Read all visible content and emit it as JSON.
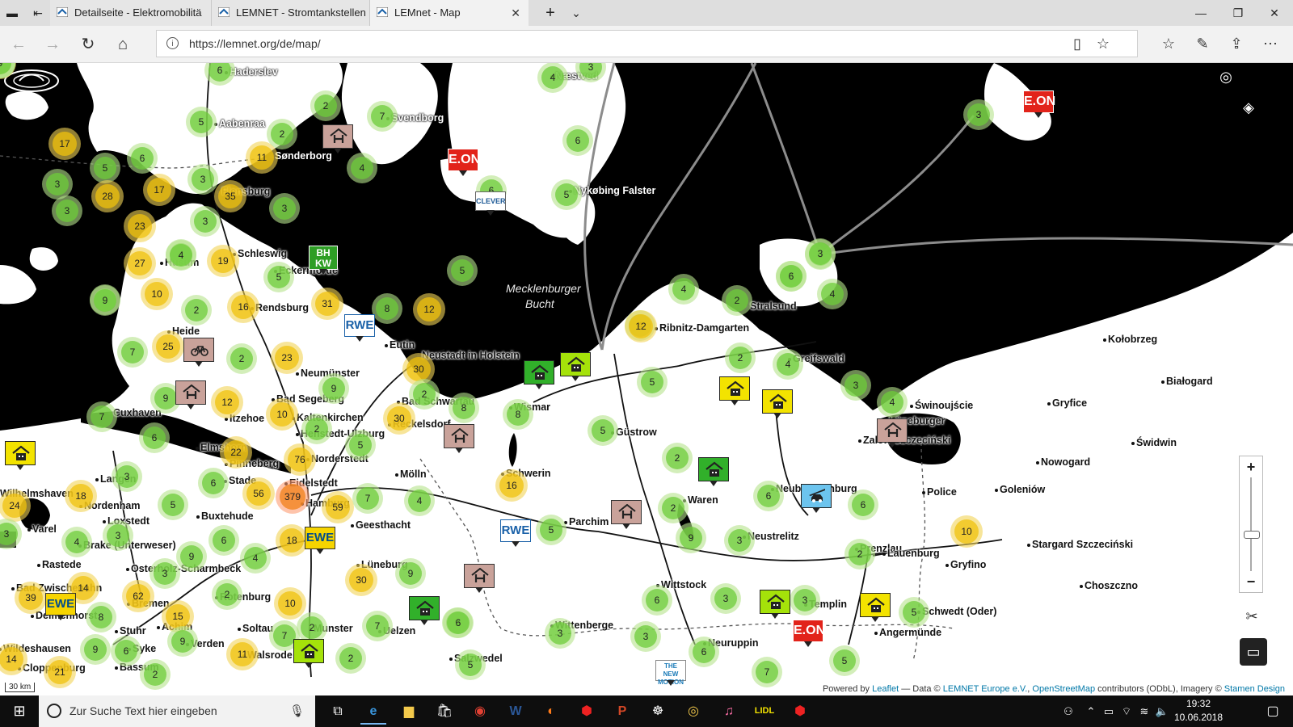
{
  "tabs": [
    {
      "label": "Detailseite - Elektromobilitä",
      "active": false
    },
    {
      "label": "LEMNET - Stromtankstellen",
      "active": false
    },
    {
      "label": "LEMnet - Map",
      "active": true
    }
  ],
  "address": {
    "url": "https://lemnet.org/de/map/"
  },
  "map": {
    "sea_label_line1": "Mecklenburger",
    "sea_label_line2": "Bucht",
    "zoom_in": "+",
    "zoom_out": "−",
    "scale": "30 km",
    "attribution": {
      "powered": "Powered by ",
      "leaflet": "Leaflet",
      "data": " — Data © ",
      "lemnet": "LEMNET Europe e.V.",
      "sep1": ", ",
      "osm": "OpenStreetMap",
      "contrib": " contributors (ODbL), Imagery © ",
      "stamen": "Stamen Design"
    },
    "places": [
      {
        "name": "Haderslev",
        "white": true
      },
      {
        "name": "Aabenraa",
        "white": true
      },
      {
        "name": "Sønderborg",
        "white": true
      },
      {
        "name": "Svendborg",
        "white": true
      },
      {
        "name": "Næstved",
        "white": true
      },
      {
        "name": "Nykøbing Falster",
        "white": true
      },
      {
        "name": "Flensburg"
      },
      {
        "name": "Schleswig"
      },
      {
        "name": "Husum"
      },
      {
        "name": "Eckernförde"
      },
      {
        "name": "Rendsburg"
      },
      {
        "name": "Heide"
      },
      {
        "name": "Eutin"
      },
      {
        "name": "Neustadt in Holstein"
      },
      {
        "name": "Neumünster"
      },
      {
        "name": "Bad Segeberg"
      },
      {
        "name": "Kaltenkirchen"
      },
      {
        "name": "Itzehoe"
      },
      {
        "name": "Cuxhaven"
      },
      {
        "name": "Henstedt-Ulzburg"
      },
      {
        "name": "Bad Schwartau"
      },
      {
        "name": "Reckelsdorf"
      },
      {
        "name": "Wismar"
      },
      {
        "name": "Elmshorn"
      },
      {
        "name": "Pinneberg"
      },
      {
        "name": "Norderstedt"
      },
      {
        "name": "Langen"
      },
      {
        "name": "Stade"
      },
      {
        "name": "Eidelstedt"
      },
      {
        "name": "Wilhelmshaven"
      },
      {
        "name": "Nordenham"
      },
      {
        "name": "Loxstedt"
      },
      {
        "name": "Buxtehude"
      },
      {
        "name": "Hamburg"
      },
      {
        "name": "Geesthacht"
      },
      {
        "name": "Mölln"
      },
      {
        "name": "Varel"
      },
      {
        "name": "Brake (Unterweser)"
      },
      {
        "name": "Rastede"
      },
      {
        "name": "Osterholz-Scharmbeck"
      },
      {
        "name": "Lüneburg"
      },
      {
        "name": "Bad Zwischenahn"
      },
      {
        "name": "Delmenhorst"
      },
      {
        "name": "Bremen"
      },
      {
        "name": "Rotenburg"
      },
      {
        "name": "Stuhr"
      },
      {
        "name": "Achim"
      },
      {
        "name": "Soltau"
      },
      {
        "name": "Munster"
      },
      {
        "name": "Uelzen"
      },
      {
        "name": "Verden"
      },
      {
        "name": "Walsrode"
      },
      {
        "name": "Syke"
      },
      {
        "name": "Bassum"
      },
      {
        "name": "Wildeshausen"
      },
      {
        "name": "Cloppenburg"
      },
      {
        "name": "Schwerin"
      },
      {
        "name": "Güstrow"
      },
      {
        "name": "Parchim"
      },
      {
        "name": "Waren"
      },
      {
        "name": "Neustrelitz"
      },
      {
        "name": "Wittstock"
      },
      {
        "name": "Wittenberge"
      },
      {
        "name": "Salzwedel"
      },
      {
        "name": "Neuruppin"
      },
      {
        "name": "Templin"
      },
      {
        "name": "Angermünde"
      },
      {
        "name": "Schwedt (Oder)"
      },
      {
        "name": "Prenzlau"
      },
      {
        "name": "Neubrandenburg"
      },
      {
        "name": "Ribnitz-Damgarten"
      },
      {
        "name": "Stralsund"
      },
      {
        "name": "Greifswald"
      },
      {
        "name": "Świnoujście"
      },
      {
        "name": "Kołobrzeg"
      },
      {
        "name": "Białogard"
      },
      {
        "name": "Gryfice"
      },
      {
        "name": "Świdwin"
      },
      {
        "name": "Nowogard"
      },
      {
        "name": "Police"
      },
      {
        "name": "Goleniów"
      },
      {
        "name": "Stargard Szczeciński"
      },
      {
        "name": "Gryfino"
      },
      {
        "name": "Choszczno"
      },
      {
        "name": "Zalew Szczeciński"
      },
      {
        "name": "Lüneburger"
      },
      {
        "name": "Lauenburg"
      }
    ],
    "clusters": [
      "6",
      "5",
      "2",
      "7",
      "4",
      "3",
      "4",
      "17",
      "5",
      "6",
      "11",
      "2",
      "3",
      "6",
      "3",
      "28",
      "17",
      "35",
      "3",
      "5",
      "3",
      "4",
      "3",
      "6",
      "23",
      "3",
      "27",
      "4",
      "19",
      "7",
      "5",
      "6",
      "5",
      "4",
      "9",
      "10",
      "2",
      "16",
      "31",
      "8",
      "12",
      "25",
      "7",
      "2",
      "23",
      "30",
      "9",
      "2",
      "8",
      "9",
      "12",
      "10",
      "2",
      "8",
      "30",
      "7",
      "6",
      "22",
      "76",
      "5",
      "3",
      "6",
      "56",
      "379",
      "59",
      "7",
      "4",
      "9",
      "3",
      "18",
      "5",
      "6",
      "4",
      "18",
      "24",
      "3",
      "4",
      "3",
      "16",
      "5",
      "9",
      "14",
      "39",
      "8",
      "62",
      "15",
      "6",
      "9",
      "2",
      "2",
      "7",
      "9",
      "30",
      "10",
      "9",
      "7",
      "3",
      "11",
      "2",
      "5",
      "21",
      "14",
      "2",
      "6",
      "3",
      "2",
      "9",
      "3",
      "6",
      "2",
      "5",
      "5",
      "3",
      "3",
      "6",
      "2",
      "2",
      "4",
      "2",
      "4",
      "6",
      "3",
      "4",
      "10",
      "5",
      "5",
      "7",
      "6",
      "12",
      "4",
      "3",
      "3",
      "6",
      "6",
      "2",
      "11",
      "2",
      "6",
      "4",
      "5",
      "9"
    ],
    "markers": {
      "eon": "E.ON",
      "rwe": "RWE",
      "ewe": "EWE",
      "bhkw_line1": "BH",
      "bhkw_line2": "KW",
      "clever": "CLEVER",
      "tnm_line1": "THE NEW",
      "tnm_line2": "MOTION"
    }
  },
  "taskbar": {
    "search_placeholder": "Zur Suche Text hier eingeben",
    "time": "19:32",
    "date": "10.06.2018"
  },
  "colors": {
    "sea": "#000000",
    "land": "#ffffff",
    "cluster_small": "#6ecc39",
    "cluster_medium": "#f0c20c",
    "cluster_large": "#f18017",
    "eon": "#e2231a"
  }
}
